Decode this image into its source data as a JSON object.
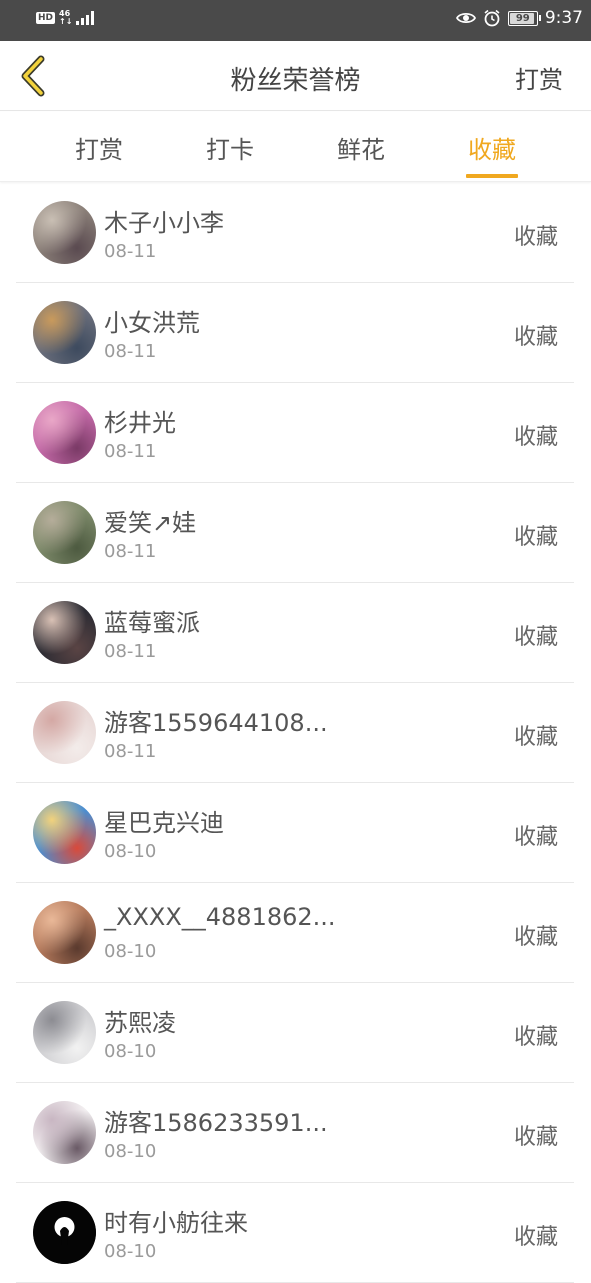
{
  "status_bar": {
    "hd": "HD",
    "network_top": "46",
    "network_bottom": "↑↓",
    "battery_level": "99",
    "battery_fraction": 0.99,
    "time": "9:37"
  },
  "header": {
    "title": "粉丝荣誉榜",
    "action_label": "打赏",
    "back_icon": "chevron-left-icon",
    "accent_color": "#f0a81f"
  },
  "tabs": [
    {
      "label": "打赏",
      "active": false
    },
    {
      "label": "打卡",
      "active": false
    },
    {
      "label": "鲜花",
      "active": false
    },
    {
      "label": "收藏",
      "active": true
    }
  ],
  "list": [
    {
      "name": "木子小小李",
      "date": "08-11",
      "action": "收藏",
      "avatar_colors": [
        "#8a7f78",
        "#c9bfb4",
        "#5a4a50"
      ]
    },
    {
      "name": "小女洪荒",
      "date": "08-11",
      "action": "收藏",
      "avatar_colors": [
        "#6b6f7c",
        "#c99a5c",
        "#3d4a5e"
      ]
    },
    {
      "name": "杉井光",
      "date": "08-11",
      "action": "收藏",
      "avatar_colors": [
        "#c46aa8",
        "#e9a7c7",
        "#7a3a66"
      ]
    },
    {
      "name": "爱笑↗娃",
      "date": "08-11",
      "action": "收藏",
      "avatar_colors": [
        "#7d8a6a",
        "#b5ad9a",
        "#4d5a40"
      ]
    },
    {
      "name": "蓝莓蜜派",
      "date": "08-11",
      "action": "收藏",
      "avatar_colors": [
        "#2b2b33",
        "#d9c1b5",
        "#5a4444"
      ]
    },
    {
      "name": "游客1559644108...",
      "date": "08-11",
      "action": "收藏",
      "avatar_colors": [
        "#e8d8d6",
        "#d4a8a4",
        "#f3ecea"
      ]
    },
    {
      "name": "星巴克兴迪",
      "date": "08-10",
      "action": "收藏",
      "avatar_colors": [
        "#4a8ed1",
        "#f2d27c",
        "#d94a3a"
      ]
    },
    {
      "name": "_XXXX__4881862...",
      "date": "08-10",
      "action": "收藏",
      "avatar_colors": [
        "#b57a5c",
        "#e9b898",
        "#5a3a2e"
      ]
    },
    {
      "name": "苏熙凌",
      "date": "08-10",
      "action": "收藏",
      "avatar_colors": [
        "#cfcfd2",
        "#8c8c92",
        "#f2f2f2"
      ]
    },
    {
      "name": "游客1586233591...",
      "date": "08-10",
      "action": "收藏",
      "avatar_colors": [
        "#f2eef0",
        "#c8b6c2",
        "#6a5a66"
      ]
    },
    {
      "name": "时有小舫往来",
      "date": "08-10",
      "action": "收藏",
      "avatar_colors": [
        "#050505",
        "#ffffff",
        "#222222"
      ]
    }
  ]
}
